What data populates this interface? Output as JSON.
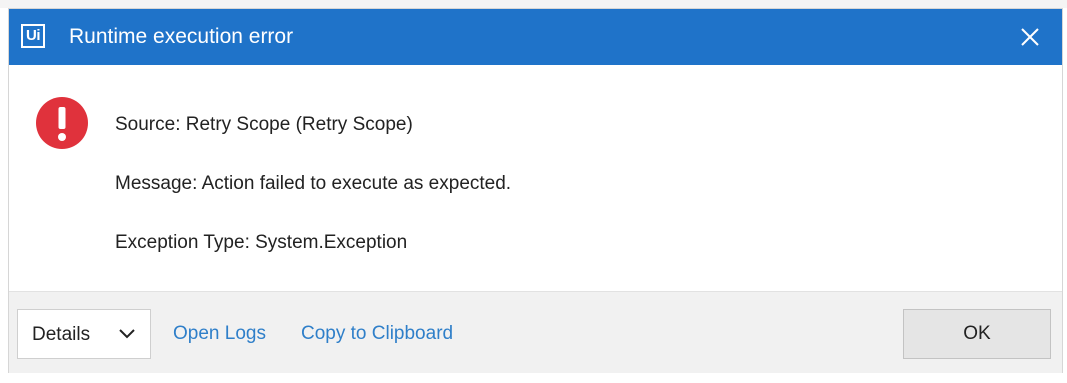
{
  "dialog": {
    "logo_text": "Ui",
    "title": "Runtime execution error",
    "close_icon": "close-icon"
  },
  "content": {
    "icon": "error-icon",
    "icon_color": "#e0323c",
    "source": "Source: Retry Scope (Retry Scope)",
    "message": "Message: Action failed to execute as expected.",
    "exception_type": "Exception Type: System.Exception"
  },
  "footer": {
    "details_label": "Details",
    "details_icon": "chevron-down-icon",
    "open_logs_label": "Open Logs",
    "copy_label": "Copy to Clipboard",
    "ok_label": "OK"
  },
  "colors": {
    "titlebar": "#1f73c9",
    "link": "#2f7fc9",
    "footer_bg": "#f1f1f1"
  }
}
